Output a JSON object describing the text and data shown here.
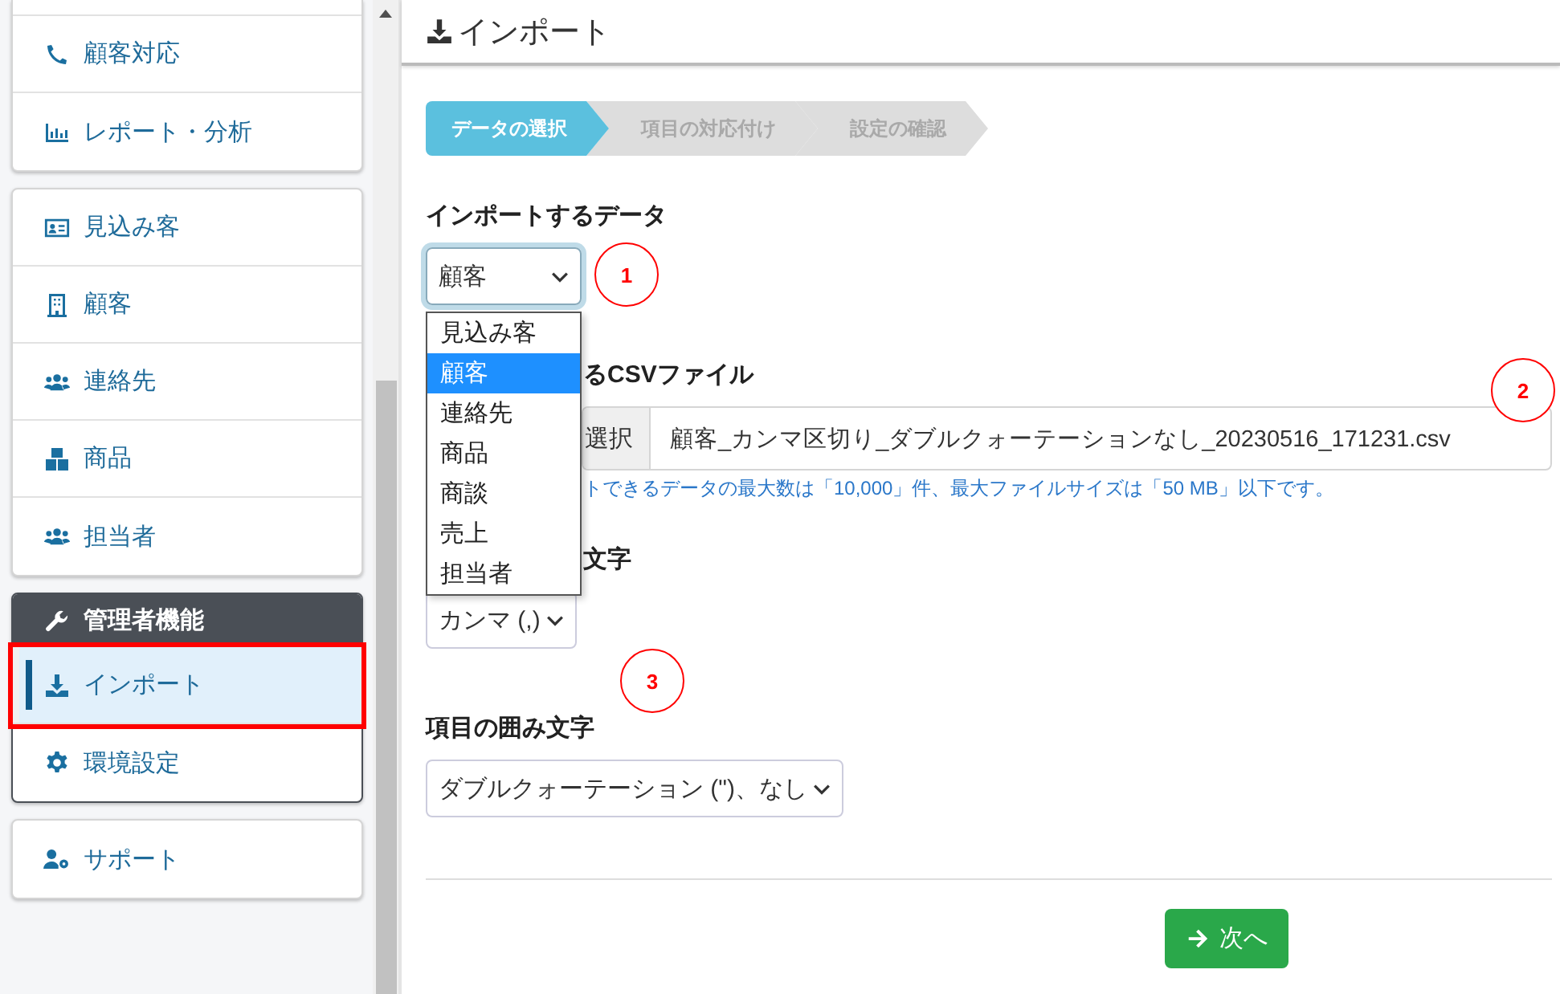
{
  "sidebar": {
    "groups": [
      {
        "kind": "card",
        "cut_top": true,
        "items": [
          {
            "label": "顧客対応",
            "selected": false,
            "annotated": false
          },
          {
            "label": "レポート・分析",
            "selected": false,
            "annotated": false
          }
        ]
      },
      {
        "kind": "card",
        "cut_top": false,
        "items": [
          {
            "label": "見込み客",
            "selected": false,
            "annotated": false
          },
          {
            "label": "顧客",
            "selected": false,
            "annotated": false
          },
          {
            "label": "連絡先",
            "selected": false,
            "annotated": false
          },
          {
            "label": "商品",
            "selected": false,
            "annotated": false
          },
          {
            "label": "担当者",
            "selected": false,
            "annotated": false
          }
        ]
      },
      {
        "kind": "admin",
        "cut_top": false,
        "title": "管理者機能",
        "items": [
          {
            "label": "インポート",
            "selected": true,
            "annotated": true
          },
          {
            "label": "環境設定",
            "selected": false,
            "annotated": false
          }
        ]
      },
      {
        "kind": "card",
        "cut_top": false,
        "items": [
          {
            "label": "サポート",
            "selected": false,
            "annotated": false
          }
        ]
      }
    ]
  },
  "page_title": "インポート",
  "steps": [
    {
      "label": "データの選択",
      "selected": true
    },
    {
      "label": "項目の対応付け",
      "selected": false
    },
    {
      "label": "設定の確認",
      "selected": false
    }
  ],
  "import_data": {
    "label": "インポートするデータ",
    "value": "顧客",
    "focused": true,
    "options": [
      {
        "label": "見込み客",
        "selected": false
      },
      {
        "label": "顧客",
        "selected": true
      },
      {
        "label": "連絡先",
        "selected": false
      },
      {
        "label": "商品",
        "selected": false
      },
      {
        "label": "商談",
        "selected": false
      },
      {
        "label": "売上",
        "selected": false
      },
      {
        "label": "担当者",
        "selected": false
      }
    ]
  },
  "csv_file": {
    "label": "るCSVファイル",
    "button": "選択",
    "filename": "顧客_カンマ区切り_ダブルクォーテーションなし_20230516_171231.csv",
    "hint": "トできるデータの最大数は「10,000」件、最大ファイルサイズは「50 MB」以下です。"
  },
  "delimiter": {
    "label": "文字",
    "value": "カンマ (,)"
  },
  "enclosure": {
    "label": "項目の囲み文字",
    "value": "ダブルクォーテーション (\")、なし"
  },
  "annotations": [
    {
      "number": "1"
    },
    {
      "number": "2"
    },
    {
      "number": "3"
    }
  ],
  "next_button": "次へ"
}
